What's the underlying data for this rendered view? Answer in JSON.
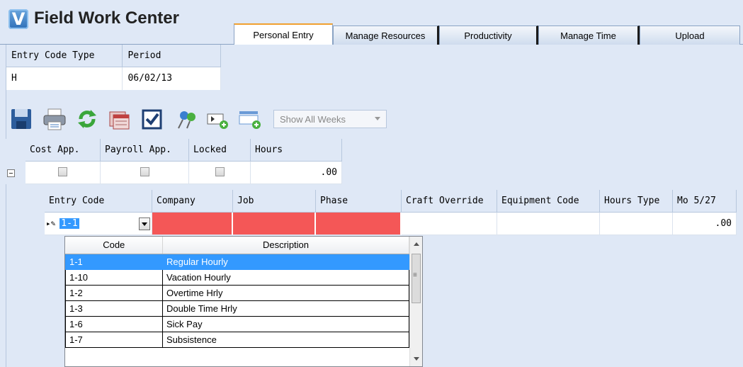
{
  "app": {
    "logo_letter": "V",
    "title": "Field Work Center"
  },
  "tabs": [
    {
      "label": "Personal Entry",
      "active": true
    },
    {
      "label": "Manage Resources",
      "active": false
    },
    {
      "label": "Productivity",
      "active": false
    },
    {
      "label": "Manage Time",
      "active": false
    },
    {
      "label": "Upload",
      "active": false
    }
  ],
  "filter": {
    "headers": [
      "Entry Code Type",
      "Period"
    ],
    "values": [
      "H",
      "06/02/13"
    ]
  },
  "toolbar": {
    "icons": [
      "save-icon",
      "print-icon",
      "refresh-icon",
      "calendar-icon",
      "checkbox-icon",
      "pin-icon",
      "add-row-icon",
      "add-column-icon"
    ],
    "week_select": "Show All Weeks"
  },
  "summary": {
    "headers": [
      "Cost App.",
      "Payroll App.",
      "Locked",
      "Hours"
    ],
    "hours": ".00"
  },
  "detail": {
    "headers": [
      "Entry Code",
      "Company",
      "Job",
      "Phase",
      "Craft Override",
      "Equipment Code",
      "Hours Type",
      "Mo 5/27"
    ],
    "entry_code_value": "1-1",
    "mo_value": ".00"
  },
  "dropdown": {
    "headers": [
      "Code",
      "Description"
    ],
    "rows": [
      {
        "code": "1-1",
        "description": "Regular Hourly"
      },
      {
        "code": "1-10",
        "description": "Vacation Hourly"
      },
      {
        "code": "1-2",
        "description": "Overtime Hrly"
      },
      {
        "code": "1-3",
        "description": "Double Time Hrly"
      },
      {
        "code": "1-6",
        "description": "Sick Pay"
      },
      {
        "code": "1-7",
        "description": "Subsistence"
      }
    ],
    "selected_index": 0
  },
  "colors": {
    "accent_tab": "#f0a030",
    "required_cell": "#f45757",
    "selection": "#3399ff",
    "background": "#dfe8f6"
  }
}
